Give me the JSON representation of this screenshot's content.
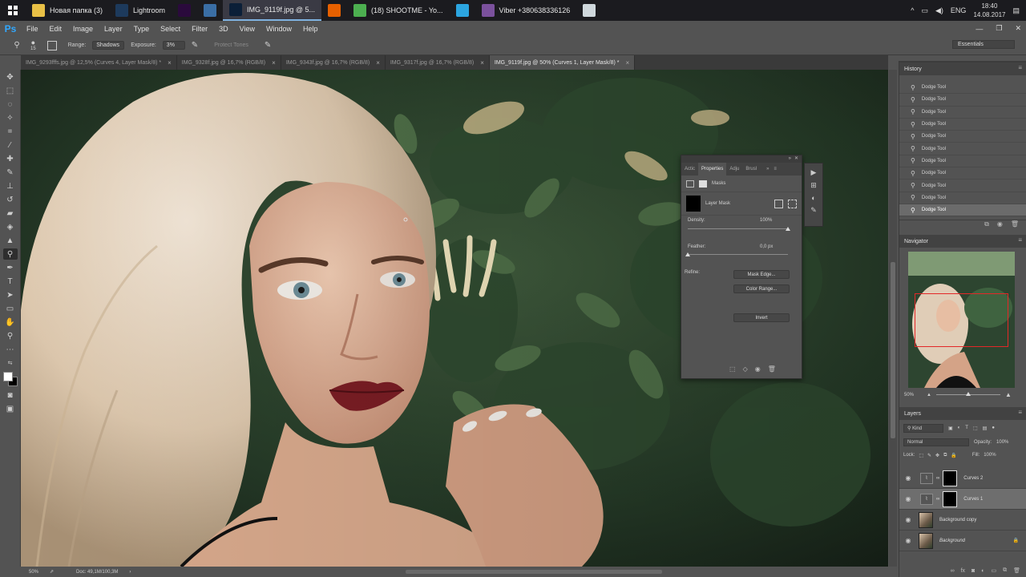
{
  "taskbar": {
    "items": [
      {
        "label": "Новая папка (3)",
        "icon": "folder-icon",
        "color": "#e9c046"
      },
      {
        "label": "Lightroom",
        "icon": "lightroom-icon",
        "color": "#1d3a5c"
      },
      {
        "label": "",
        "icon": "premiere-icon",
        "color": "#2a0a3c"
      },
      {
        "label": "",
        "icon": "image-viewer-icon",
        "color": "#3a6ea5"
      },
      {
        "label": "IMG_9119f.jpg @ 5...",
        "icon": "photoshop-icon",
        "color": "#0b1f38"
      },
      {
        "label": "",
        "icon": "firefox-icon",
        "color": "#e66000"
      },
      {
        "label": "(18) SHOOTME - Yo...",
        "icon": "chrome-icon",
        "color": "#4caf50"
      },
      {
        "label": "",
        "icon": "telegram-icon",
        "color": "#2ca5e0"
      },
      {
        "label": "Viber +380638336126",
        "icon": "viber-icon",
        "color": "#7b519d"
      },
      {
        "label": "",
        "icon": "document-icon",
        "color": "#cfd8dc"
      }
    ],
    "lang": "ENG",
    "time": "18:40",
    "date": "14.08.2017"
  },
  "menubar": {
    "logo": "Ps",
    "items": [
      "File",
      "Edit",
      "Image",
      "Layer",
      "Type",
      "Select",
      "Filter",
      "3D",
      "View",
      "Window",
      "Help"
    ]
  },
  "options": {
    "brush_size": "15",
    "range_label": "Range:",
    "range_value": "Shadows",
    "exposure_label": "Exposure:",
    "exposure_value": "3%",
    "protect_tones": "Protect Tones",
    "workspace": "Essentials"
  },
  "tabs": [
    {
      "label": "IMG_9293fffs.jpg @ 12,5% (Curves 4, Layer Mask/8) *",
      "active": false
    },
    {
      "label": "IMG_9328f.jpg @ 16,7% (RGB/8)",
      "active": false
    },
    {
      "label": "IMG_9343f.jpg @ 16,7% (RGB/8)",
      "active": false
    },
    {
      "label": "IMG_9317f.jpg @ 16,7% (RGB/8)",
      "active": false
    },
    {
      "label": "IMG_9119f.jpg @ 50% (Curves 1, Layer Mask/8) *",
      "active": true
    }
  ],
  "status": {
    "zoom": "50%",
    "doc": "Doc: 49,1M/100,3M"
  },
  "properties": {
    "tabs": [
      "Actic",
      "Properties",
      "Adju",
      "Brusl"
    ],
    "section": "Masks",
    "layer_mask": "Layer Mask",
    "density_label": "Density:",
    "density_value": "100%",
    "density": 1.0,
    "feather_label": "Feather:",
    "feather_value": "0,0 px",
    "feather": 0.0,
    "refine_label": "Refine:",
    "mask_edge": "Mask Edge...",
    "color_range": "Color Range...",
    "invert": "Invert"
  },
  "history": {
    "title": "History",
    "items": [
      "Dodge Tool",
      "Dodge Tool",
      "Dodge Tool",
      "Dodge Tool",
      "Dodge Tool",
      "Dodge Tool",
      "Dodge Tool",
      "Dodge Tool",
      "Dodge Tool",
      "Dodge Tool",
      "Dodge Tool"
    ]
  },
  "navigator": {
    "title": "Navigator",
    "zoom": "50%"
  },
  "layers": {
    "title": "Layers",
    "filter": "Kind",
    "blend": "Normal",
    "opacity_label": "Opacity:",
    "opacity": "100%",
    "lock_label": "Lock:",
    "fill_label": "Fill:",
    "fill": "100%",
    "items": [
      {
        "name": "Curves 2",
        "type": "adjustment",
        "active": false
      },
      {
        "name": "Curves 1",
        "type": "adjustment",
        "active": true
      },
      {
        "name": "Background copy",
        "type": "image",
        "active": false
      },
      {
        "name": "Background",
        "type": "image",
        "active": false,
        "locked": true
      }
    ]
  }
}
